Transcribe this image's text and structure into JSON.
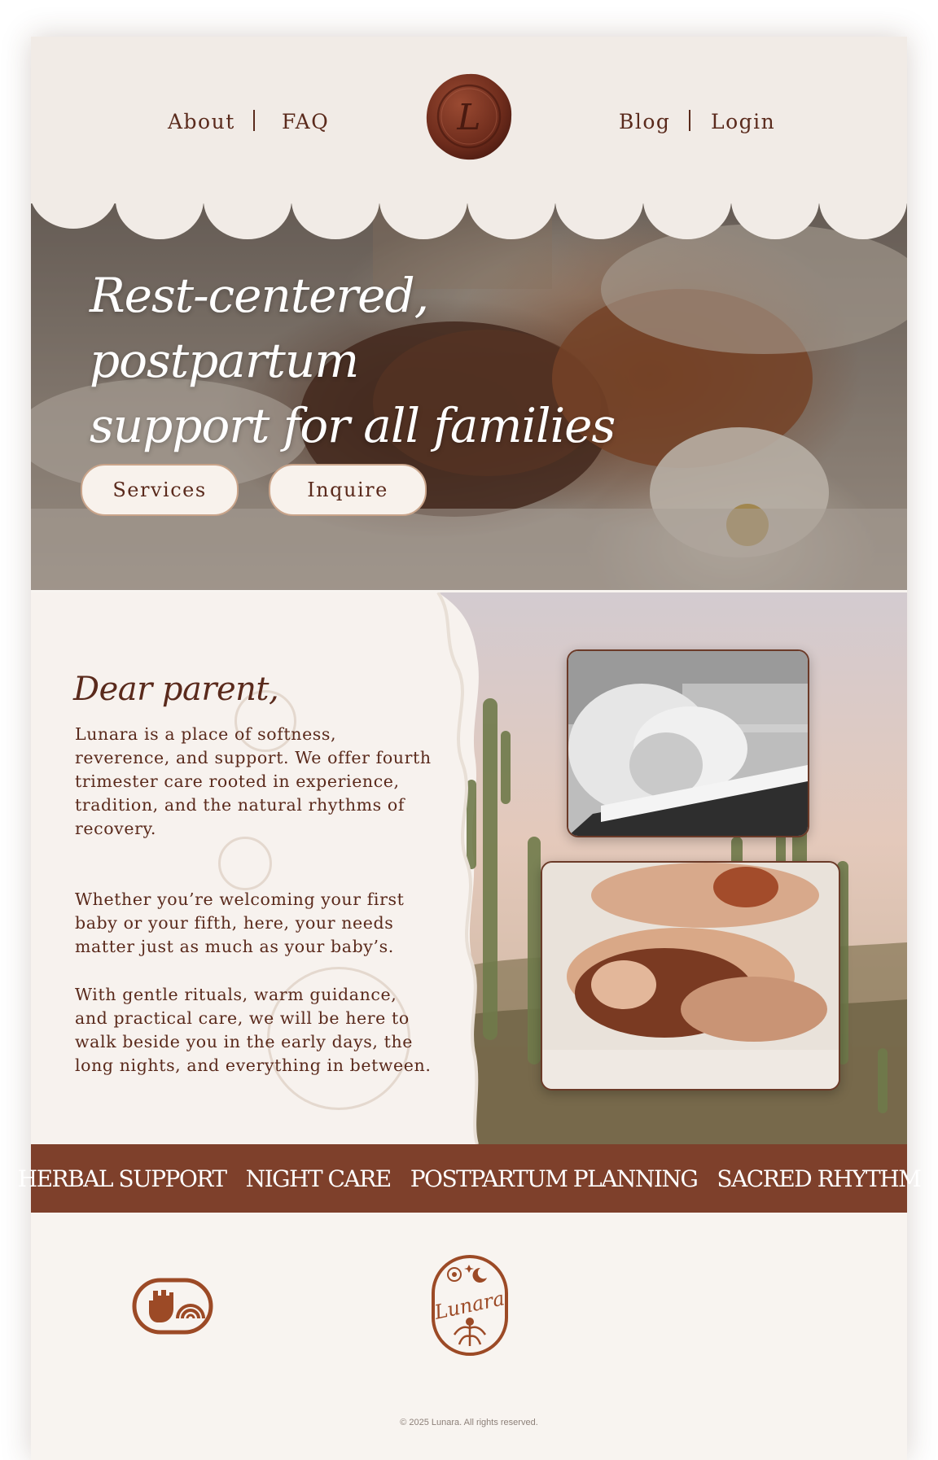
{
  "nav": {
    "about": "About",
    "faq": "FAQ",
    "blog": "Blog",
    "login": "Login",
    "seal_letter": "L"
  },
  "hero": {
    "title_line1": "Rest-centered, postpartum",
    "title_line2": "support for all families",
    "services_label": "Services",
    "inquire_label": "Inquire"
  },
  "letter": {
    "greeting": "Dear parent,",
    "paragraph1": "Lunara is a place of softness, reverence, and support. We offer fourth trimester care rooted in experience, tradition, and the natural rhythms of recovery.",
    "paragraph2": "Whether you’re welcoming your first baby or your fifth, here, your needs matter just as much as your baby’s.",
    "paragraph3": "With gentle rituals, warm guidance, and practical care, we will be here to walk beside you in the early days, the long nights, and everything in between."
  },
  "band": {
    "items": [
      "HERBAL SUPPORT",
      "NIGHT CARE",
      "POSTPARTUM PLANNING",
      "SACRED RHYTHM"
    ]
  },
  "footer": {
    "logo_text": "Lunara",
    "copyright": "© 2025 Lunara. All rights reserved."
  },
  "colors": {
    "brand_brown": "#7e402b",
    "text_brown": "#5a2a1c",
    "header_bg": "#f1ebe6",
    "page_bg": "#f8f4f0"
  },
  "icons": {
    "seal": "wax-seal-icon",
    "badge": "fist-rainbow-badge-icon",
    "logo": "lunara-floral-logo-icon"
  }
}
